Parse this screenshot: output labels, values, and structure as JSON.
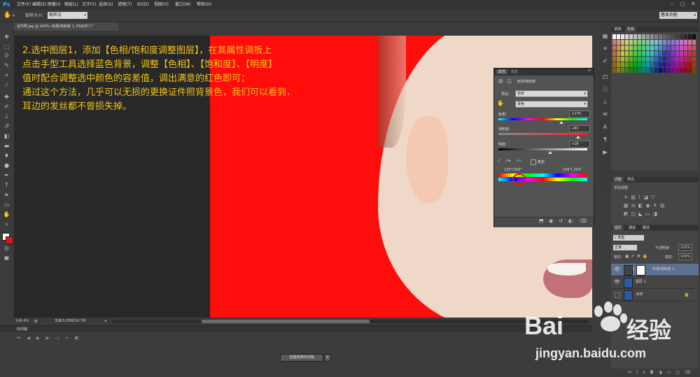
{
  "app": {
    "logo": "Ps"
  },
  "menu": [
    "文件(F)",
    "编辑(E)",
    "图像(I)",
    "图层(L)",
    "文字(Y)",
    "选择(S)",
    "滤镜(T)",
    "3D(D)",
    "视图(V)",
    "窗口(W)",
    "帮助(H)"
  ],
  "options_bar": {
    "sample_size_label": "取样大小：",
    "sample_size_value": "取样点",
    "workspace": "基本功能"
  },
  "document": {
    "tab_title": "证件照.jpg @ 149% (色相/饱和度 1, RGB/8*) *",
    "zoom": "149.4%",
    "doc_size": "文档:5.83M/19.7M"
  },
  "annotation": {
    "lines": [
      "2.选中图层1，添加【色相/饱和度调整图层】，在其属性调板上",
      "点击手型工具选择蓝色背景，调整【色相】、【饱和度】、【明度】",
      "值时配合调整选中颜色的容差值，调出满意的红色即可；",
      "通过这个方法，几乎可以无损的更换证件照背景色，我们可以看到，",
      "耳边的发丝都不曾损失掉。"
    ]
  },
  "properties_panel": {
    "tab_properties": "属性",
    "tab_info": "信息",
    "adj_title": "色相/饱和度",
    "preset_label": "预设：",
    "preset_value": "自定",
    "channel_value": "青色",
    "hue_label": "色相：",
    "hue_value": "+170",
    "saturation_label": "饱和度：",
    "saturation_value": "+81",
    "lightness_label": "明度：",
    "lightness_value": "+16",
    "colorize_label": "着色",
    "range_left": "135°/165°",
    "range_right": "195°\\ 263°",
    "hue_level": 0.71,
    "saturation_level": 0.9,
    "lightness_level": 0.58
  },
  "swatches_panel": {
    "tab_color": "颜色",
    "tab_swatches": "色板"
  },
  "adjustments_panel": {
    "tab_adjust": "调整",
    "tab_styles": "样式",
    "title": "添加调整"
  },
  "layers_panel": {
    "tab_layers": "图层",
    "tab_channels": "通道",
    "tab_paths": "路径",
    "filter_kind": "类型",
    "blend_mode": "正常",
    "opacity_label": "不透明度：",
    "opacity_value": "100%",
    "lock_label": "锁定：",
    "fill_label": "填充：",
    "fill_value": "100%",
    "layers": [
      {
        "name": "色相/饱和度 1"
      },
      {
        "name": "图层 1"
      },
      {
        "name": "背景"
      }
    ]
  },
  "timeline": {
    "tab": "时间轴",
    "create_button": "创建视频时间轴"
  },
  "watermark": {
    "brand": "Bai",
    "brand2": "经验",
    "url": "jingyan.baidu.com"
  }
}
